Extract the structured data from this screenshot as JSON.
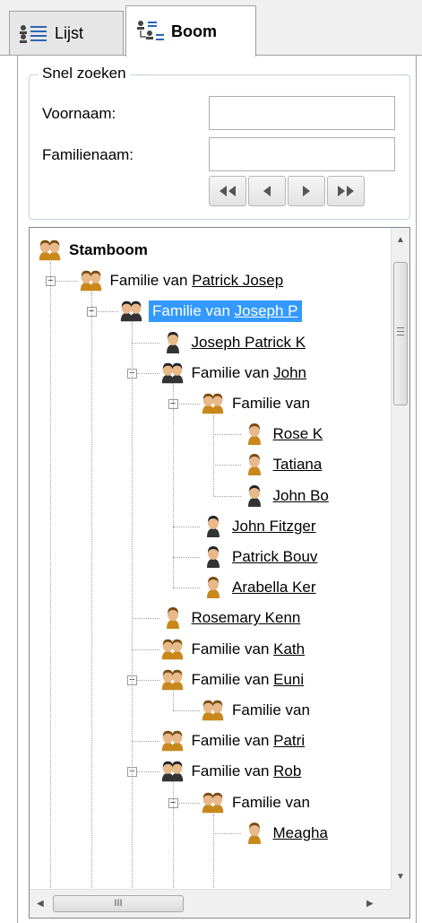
{
  "tabs": [
    {
      "label": "Lijst",
      "icon": "list-people-icon"
    },
    {
      "label": "Boom",
      "icon": "tree-people-icon"
    }
  ],
  "search": {
    "legend": "Snel zoeken",
    "first_name_label": "Voornaam:",
    "first_name_value": "",
    "last_name_label": "Familienaam:",
    "last_name_value": "",
    "nav_buttons": [
      "first-icon",
      "prev-icon",
      "next-icon",
      "last-icon"
    ]
  },
  "tree": {
    "root": "Stamboom",
    "nodes": [
      {
        "prefix": "Familie van ",
        "name": "Patrick Josep",
        "icon": "couple-icon",
        "depth": 1
      },
      {
        "prefix": "Familie van ",
        "name": "Joseph P",
        "icon": "couple-dark-icon",
        "depth": 2,
        "selected": true
      },
      {
        "prefix": "",
        "name": "Joseph Patrick K",
        "icon": "man-icon",
        "depth": 3
      },
      {
        "prefix": "Familie van ",
        "name": "John",
        "icon": "couple-dark-icon",
        "depth": 3
      },
      {
        "prefix": "Familie van",
        "name": "",
        "icon": "couple-icon",
        "depth": 4
      },
      {
        "prefix": "",
        "name": "Rose K",
        "icon": "woman-icon",
        "depth": 5
      },
      {
        "prefix": "",
        "name": "Tatiana",
        "icon": "woman-icon",
        "depth": 5
      },
      {
        "prefix": "",
        "name": "John Bo",
        "icon": "man-icon",
        "depth": 5
      },
      {
        "prefix": "",
        "name": "John Fitzger",
        "icon": "man-icon",
        "depth": 4
      },
      {
        "prefix": "",
        "name": "Patrick Bouv",
        "icon": "man-icon",
        "depth": 4
      },
      {
        "prefix": "",
        "name": "Arabella Ker",
        "icon": "woman-icon",
        "depth": 4
      },
      {
        "prefix": "",
        "name": "Rosemary Kenn",
        "icon": "woman-icon",
        "depth": 3
      },
      {
        "prefix": "Familie van ",
        "name": "Kath",
        "icon": "couple-icon",
        "depth": 3
      },
      {
        "prefix": "Familie van ",
        "name": "Euni",
        "icon": "couple-icon",
        "depth": 3
      },
      {
        "prefix": "Familie van",
        "name": "",
        "icon": "couple-icon",
        "depth": 4
      },
      {
        "prefix": "Familie van ",
        "name": "Patri",
        "icon": "couple-icon",
        "depth": 3
      },
      {
        "prefix": "Familie van ",
        "name": "Rob",
        "icon": "couple-dark-icon",
        "depth": 3
      },
      {
        "prefix": "Familie van",
        "name": "",
        "icon": "couple-icon",
        "depth": 4
      },
      {
        "prefix": "",
        "name": "Meagha",
        "icon": "woman-icon",
        "depth": 5
      }
    ]
  },
  "hscroll_grip": "III"
}
